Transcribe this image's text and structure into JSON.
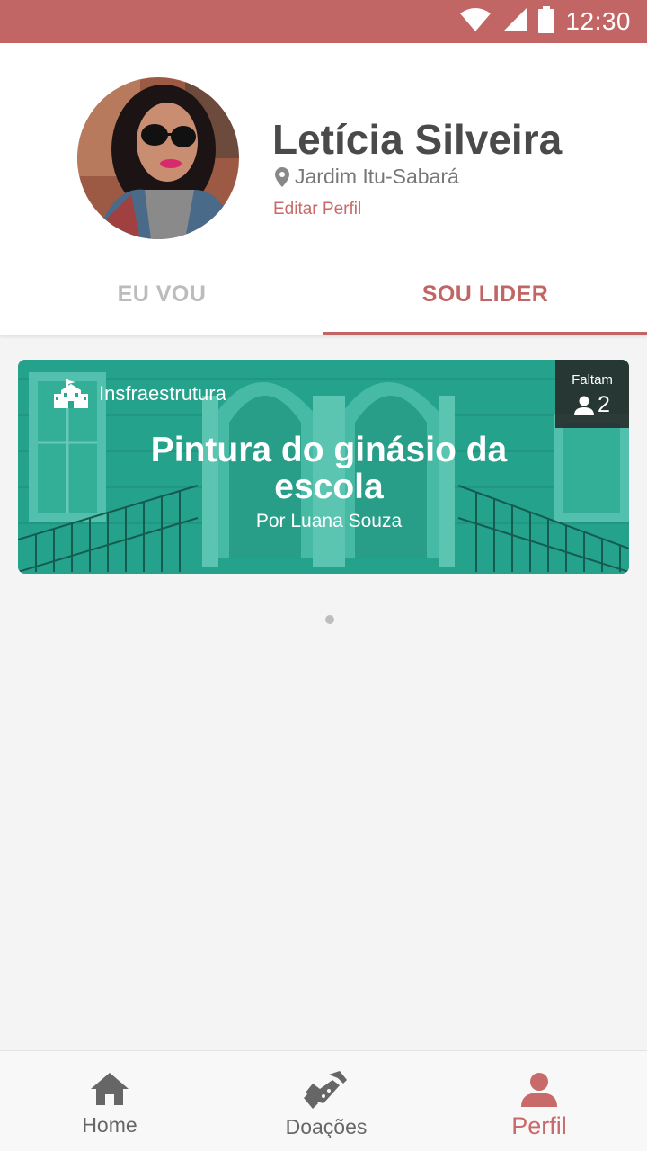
{
  "status_bar": {
    "time": "12:30",
    "icons": [
      "wifi-icon",
      "cell-signal-icon",
      "battery-icon"
    ],
    "background": "#c26565"
  },
  "profile": {
    "name": "Letícia Silveira",
    "location": "Jardim Itu-Sabará",
    "edit_label": "Editar Perfil",
    "avatar_icon": "profile-photo"
  },
  "tabs": [
    {
      "label": "EU VOU",
      "active": false
    },
    {
      "label": "SOU LIDER",
      "active": true
    }
  ],
  "card": {
    "category": "Insfraestrutura",
    "category_icon": "school-building-icon",
    "title": "Pintura do ginásio da escola",
    "author": "Por Luana Souza",
    "missing_label": "Faltam",
    "missing_count": "2",
    "missing_icon": "person-icon",
    "overlay_color": "#2ea894"
  },
  "pager": {
    "pages": 1,
    "current": 1
  },
  "bottom_nav": {
    "items": [
      {
        "label": "Home",
        "icon": "home-icon",
        "active": false
      },
      {
        "label": "Doações",
        "icon": "handshake-icon",
        "active": false
      },
      {
        "label": "Perfil",
        "icon": "person-icon",
        "active": true
      }
    ]
  },
  "colors": {
    "accent": "#c26565",
    "text_dark": "#4a4a4a",
    "inactive": "#bcbcbc"
  }
}
